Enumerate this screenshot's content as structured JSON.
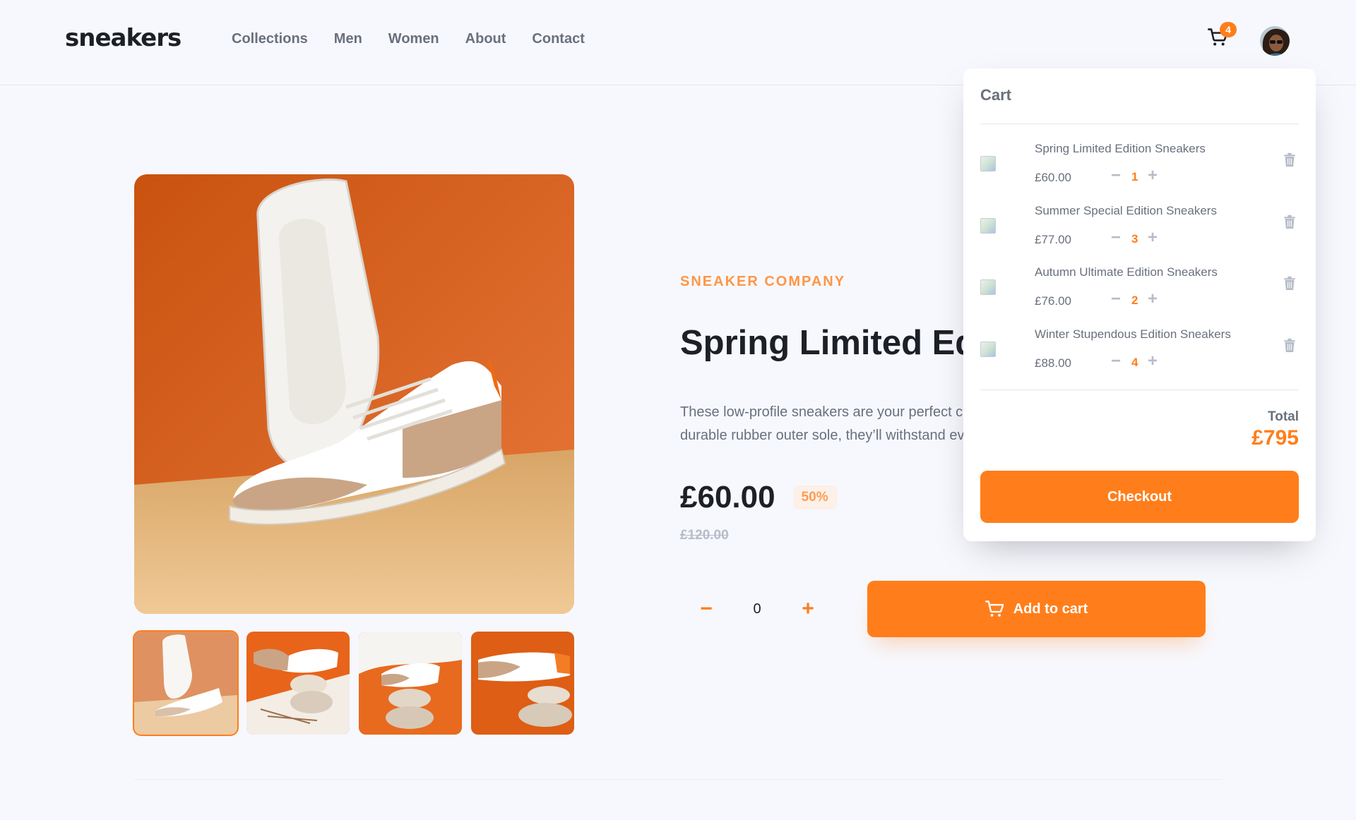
{
  "header": {
    "logo": "sneakers",
    "nav": [
      "Collections",
      "Men",
      "Women",
      "About",
      "Contact"
    ],
    "cart_badge": "4"
  },
  "product": {
    "company": "SNEAKER COMPANY",
    "title": "Spring Limited Edition Sneakers",
    "description_line1": "These low-profile sneakers are your perfect casual wear companion. Featuring a",
    "description_line2": "durable rubber outer sole, they’ll withstand everything the weather can offer.",
    "price": "£60.00",
    "discount": "50%",
    "old_price": "£120.00",
    "quantity": "0",
    "add_to_cart": "Add to cart",
    "minus": "−",
    "plus": "+"
  },
  "cart": {
    "title": "Cart",
    "items": [
      {
        "name": "Spring Limited Edition Sneakers",
        "price": "£60.00",
        "qty": "1"
      },
      {
        "name": "Summer Special Edition Sneakers",
        "price": "£77.00",
        "qty": "3"
      },
      {
        "name": "Autumn Ultimate Edition Sneakers",
        "price": "£76.00",
        "qty": "2"
      },
      {
        "name": "Winter Stupendous Edition Sneakers",
        "price": "£88.00",
        "qty": "4"
      }
    ],
    "total_label": "Total",
    "total_value": "£795",
    "checkout": "Checkout",
    "minus": "−",
    "plus": "+"
  },
  "colors": {
    "accent": "#ff7e1b",
    "text_dark": "#1d2026",
    "text_muted": "#69707d",
    "background": "#f7f8fd"
  }
}
